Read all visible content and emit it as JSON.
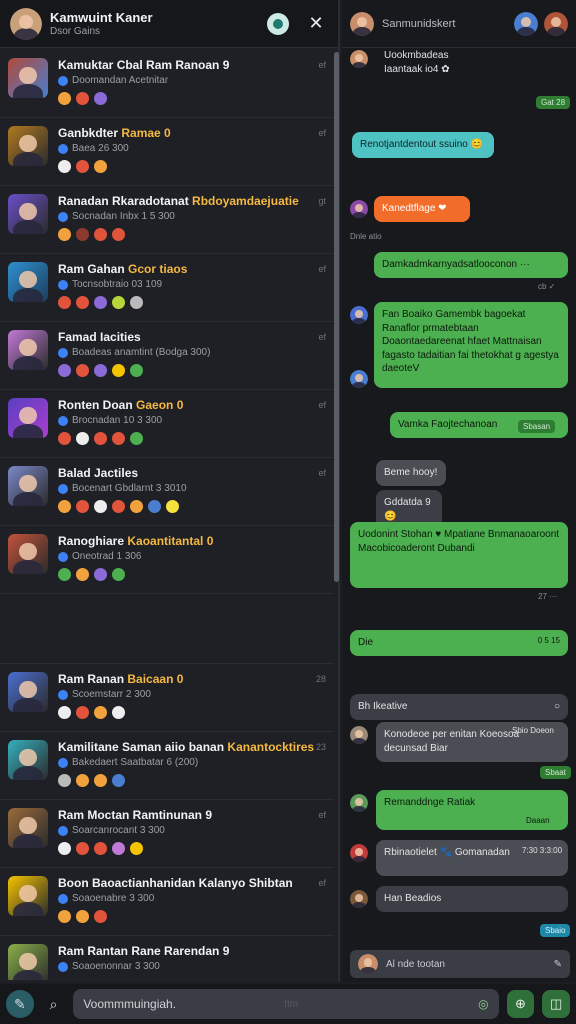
{
  "left_header": {
    "title": "Kamwuint Kaner",
    "subtitle": "Dsor Gains"
  },
  "contacts": [
    {
      "name": "Kamuktar Cbal Ram Ranoan 9",
      "sub": "Doomandan Acetnitar",
      "time": "ef",
      "colors": [
        "#b04a3a",
        "#4a7ed0"
      ],
      "icons": [
        "#f2a23c",
        "#e2533b",
        "#8c6ad8"
      ]
    },
    {
      "name": "Ganbkdter",
      "hl": "Ramae 0",
      "sub": "Baea 26 300",
      "time": "ef",
      "colors": [
        "#b07a20",
        "#2b2b2b"
      ],
      "icons": [
        "#eeeeee",
        "#e2533b",
        "#f2a23c"
      ]
    },
    {
      "name": "Ranadan Rkaradotanat",
      "hl": "Rbdoyamdaejuatie",
      "sub": "Socnadan Inbx 1 5 300",
      "time": "gt",
      "colors": [
        "#6a4fc9",
        "#2b2b2b"
      ],
      "icons": [
        "#f2a23c",
        "#8b3a2e",
        "#e2533b",
        "#e2533b"
      ]
    },
    {
      "name": "Ram Gahan",
      "hl": "Gcor tiaos",
      "sub": "Tocnsobtraio 03 109",
      "time": "ef",
      "colors": [
        "#2f8fd0",
        "#1c3e5a"
      ],
      "icons": [
        "#e2533b",
        "#e2533b",
        "#8c6ad8",
        "#b6d63a",
        "#bbbbbb"
      ]
    },
    {
      "name": "Famad Iacities",
      "sub": "Boadeas anamtint (Bodga 300)",
      "time": "ef",
      "colors": [
        "#c27ad8",
        "#2b2b2b"
      ],
      "icons": [
        "#8c6ad8",
        "#e2533b",
        "#8c6ad8",
        "#f5c400",
        "#4caf50"
      ]
    },
    {
      "name": "Ronten Doan",
      "hl": "Gaeon 0",
      "sub": "Brocnadan 10 3 300",
      "time": "ef",
      "colors": [
        "#5a3fc0",
        "#a83ed0"
      ],
      "icons": [
        "#e2533b",
        "#eeeeee",
        "#e2533b",
        "#e2533b",
        "#4caf50"
      ]
    },
    {
      "name": "Balad Jactiles",
      "sub": "Bocenart Gbdlarnt 3 3010",
      "time": "ef",
      "colors": [
        "#7b88c9",
        "#2b2b2b"
      ],
      "icons": [
        "#f2a23c",
        "#e2533b",
        "#eeeeee",
        "#e2533b",
        "#f2a23c",
        "#4a7ed0",
        "#f5e23c"
      ]
    },
    {
      "name": "Ranoghiare",
      "hl": "Kaoantitantal 0",
      "sub": "Oneotrad 1 306",
      "time": "",
      "colors": [
        "#c2533b",
        "#2b2b2b"
      ],
      "icons": [
        "#4caf50",
        "#f2a23c",
        "#8c6ad8",
        "#4caf50"
      ]
    },
    {
      "gap": true
    },
    {
      "name": "Ram Ranan",
      "hl": "Baicaan 0",
      "sub": "Scoemstarr 2 300",
      "time": "28",
      "colors": [
        "#4a6fd0",
        "#2b2b2b"
      ],
      "icons": [
        "#eeeeee",
        "#e2533b",
        "#f2a23c",
        "#eeeeee"
      ]
    },
    {
      "name": "Kamilitane Saman aiio banan",
      "hl": "Kanantocktires",
      "sub": "Bakedaert Saatbatar 6 (200)",
      "time": "23",
      "colors": [
        "#35b0c0",
        "#2b2b2b"
      ],
      "icons": [
        "#bbbbbb",
        "#f2a23c",
        "#f2a23c",
        "#4a7ed0"
      ]
    },
    {
      "name": "Ram Moctan Ramtinunan 9",
      "sub": "Soarcanrocant 3 300",
      "time": "ef",
      "colors": [
        "#9a6a3a",
        "#2b2b2b"
      ],
      "icons": [
        "#eeeeee",
        "#e2533b",
        "#e2533b",
        "#c27ad8",
        "#f5c400"
      ]
    },
    {
      "name": "Boon Baoactianhanidan Kalanyo Shibtan",
      "sub": "Soaoenabre 3 300",
      "time": "ef",
      "colors": [
        "#f5c400",
        "#2b2b2b"
      ],
      "icons": [
        "#f2a23c",
        "#f2a23c",
        "#e2533b"
      ]
    },
    {
      "name": "Ram Rantan Rane Rarendan 9",
      "sub": "Soaoenonnar 3 300",
      "time": "",
      "colors": [
        "#8ab04a",
        "#2b2b2b"
      ],
      "icons": []
    }
  ],
  "right_header": {
    "title": "Sanmunidskert"
  },
  "messages": {
    "m1_title": "Uookmbadeas",
    "m1_text": "Iaantaak io4 ✿",
    "m1_tag": "Gat 28",
    "m2": "Renotjantdentout ssuino 😊",
    "m3": "Kanedtflage ❤",
    "m3_meta": "Dnle atio",
    "m4": "Damkadmkarnyadsatlooconon ···",
    "m4_time": "cb ✓",
    "m5": "Fan Boaiko Gamembk bagoekat Ranaflor prmatebtaan Doaontaedareenat hfaet Mattnaisan fagasto tadaitian fai thetokhat g agestya daeoteV",
    "m5_time": "···",
    "m6": "Vamka Faojtechanoan",
    "m6_tag": "Sbasan",
    "m7": "Beme hooy!",
    "m8": "Gddatda 9 😊",
    "m9": "Uodonint Stohan ♥ Mpatiane Bnmanaoaroont Macobicoaderont Dubandi",
    "m9_time": "27 ···",
    "m10": "Die",
    "m10_time": "0 5 15",
    "input1": "Bh Ikeative",
    "m11": "Konodeoe per enitan Koeosoa decunsad Biar",
    "m11_time": "Sbio Doeon",
    "m11_tag": "Sbaat",
    "m12": "Remanddnge Ratiak",
    "m12_time": "Daaan",
    "m13": "Rbinaotielet 🐾 Gomanadan",
    "m13_time": "7:30 3:3:00",
    "m14": "Han Beadios",
    "m14_tag": "Sbaio",
    "right_input_placeholder": "Al nde tootan"
  },
  "bottom": {
    "compose_placeholder": "Voommmuingiah.",
    "compose_mid": "ftm"
  }
}
